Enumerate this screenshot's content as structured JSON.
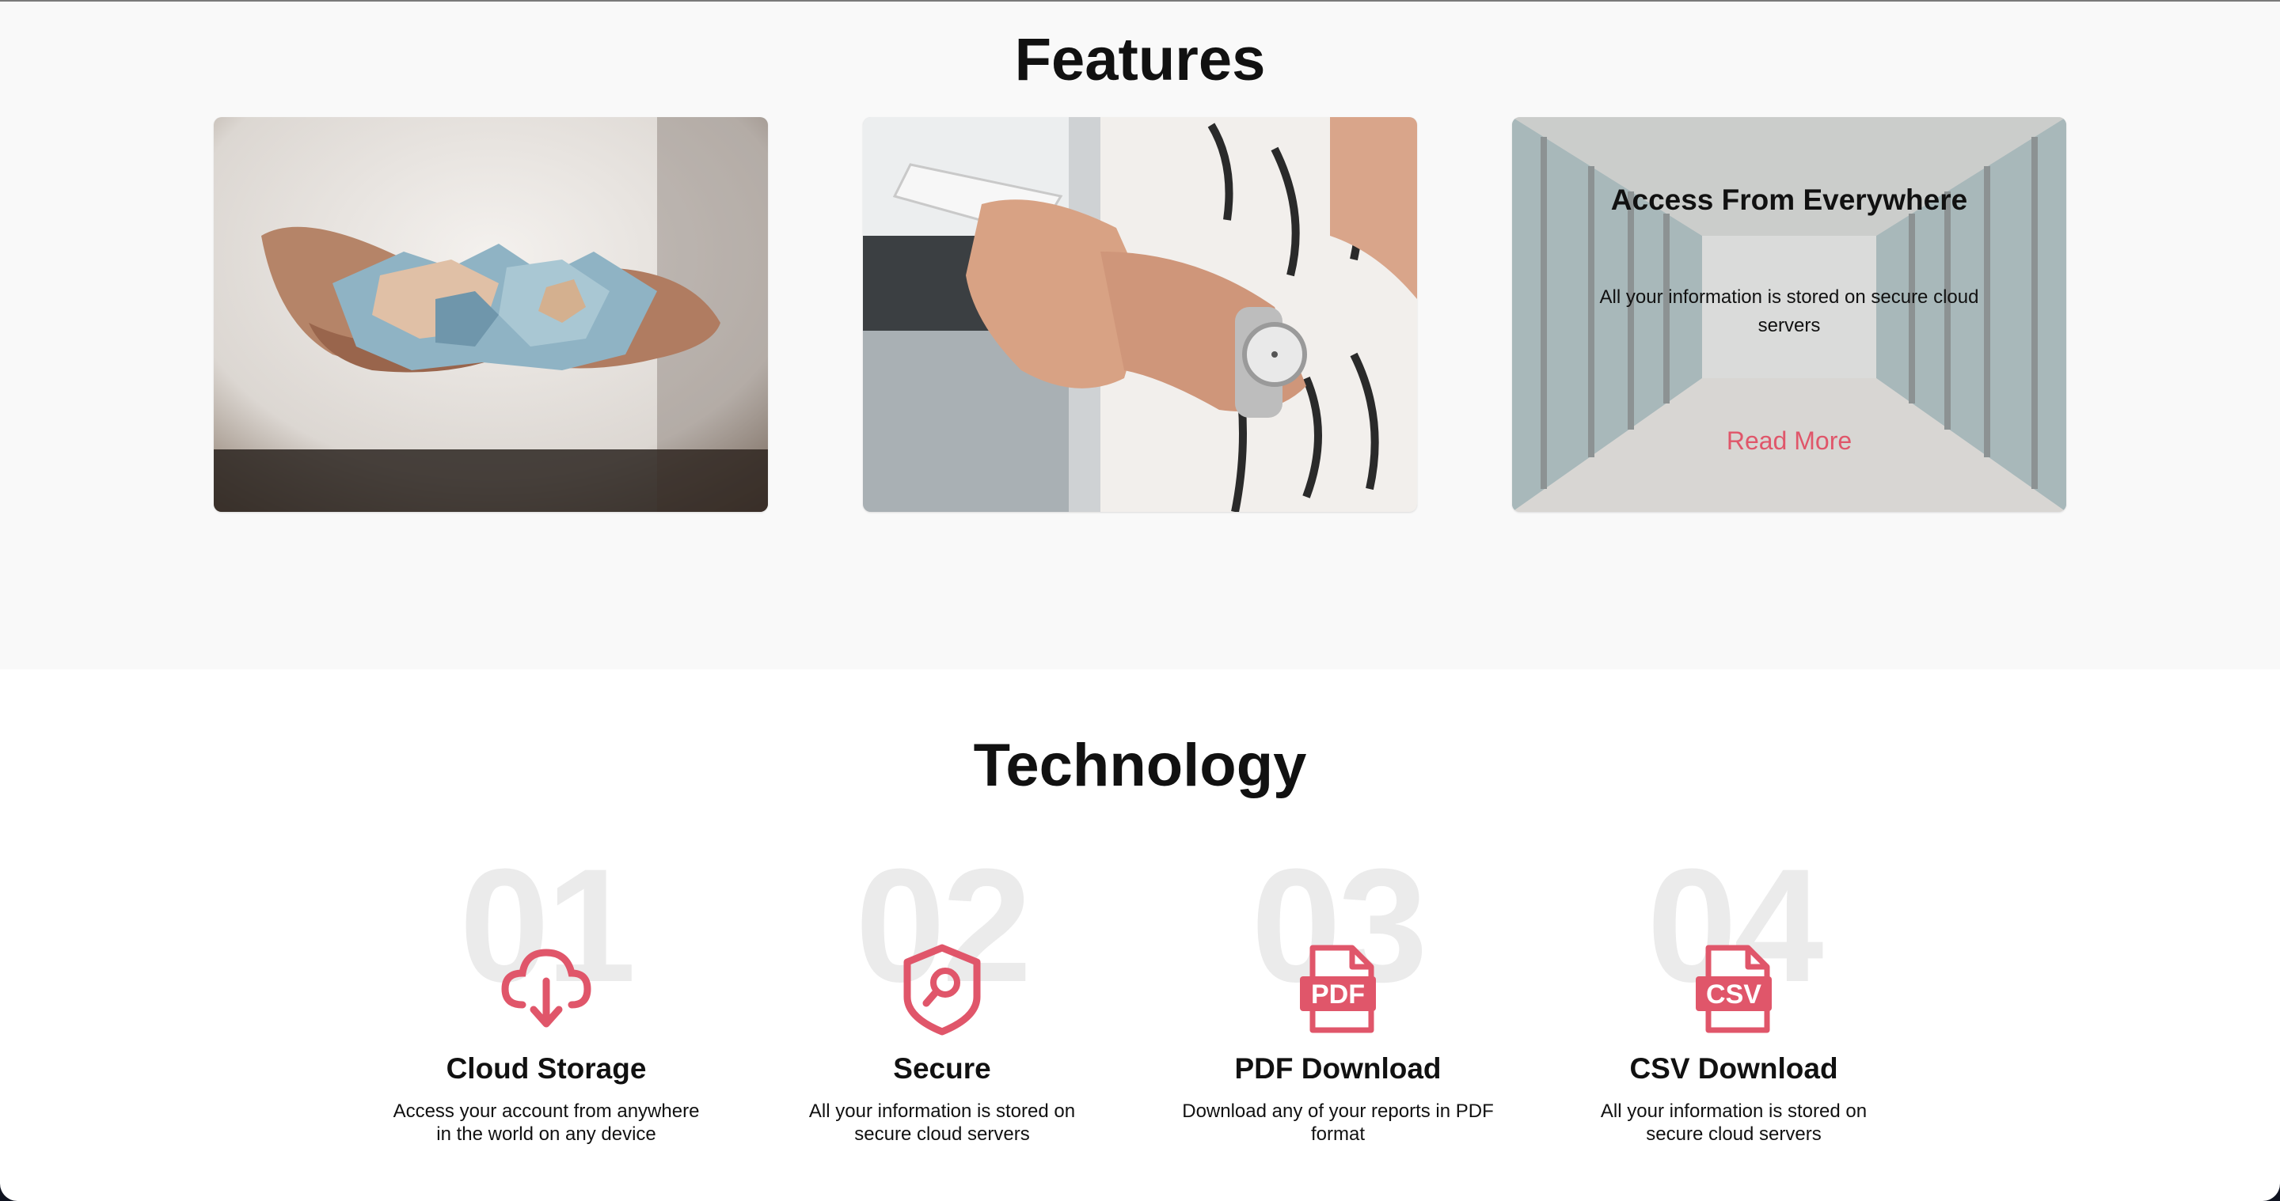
{
  "features": {
    "title": "Features",
    "cards": [
      {
        "image": "hands-holding-money-photo"
      },
      {
        "image": "hands-holding-phone-photo"
      },
      {
        "image": "glass-corridor-photo",
        "overlay_title": "Access From Everywhere",
        "overlay_text": "All your information is stored on secure cloud servers",
        "link_label": "Read More"
      }
    ]
  },
  "technology": {
    "title": "Technology",
    "items": [
      {
        "number": "01",
        "icon": "cloud-download-icon",
        "title": "Cloud Storage",
        "desc_line1": "Access your account from anywhere",
        "desc_line2": "in the world on any device"
      },
      {
        "number": "02",
        "icon": "shield-search-icon",
        "title": "Secure",
        "desc_line1": "All your information is stored on",
        "desc_line2": "secure cloud servers"
      },
      {
        "number": "03",
        "icon": "pdf-file-icon",
        "title": "PDF Download",
        "desc_line1": "Download any of your reports in PDF",
        "desc_line2": "format"
      },
      {
        "number": "04",
        "icon": "csv-file-icon",
        "title": "CSV Download",
        "desc_line1": "All your information is stored on",
        "desc_line2": "secure cloud servers"
      }
    ]
  },
  "colors": {
    "accent": "#e0566a",
    "features_bg": "#f9f9f9",
    "number_watermark": "#ebebeb",
    "frame": "#0f1320"
  }
}
